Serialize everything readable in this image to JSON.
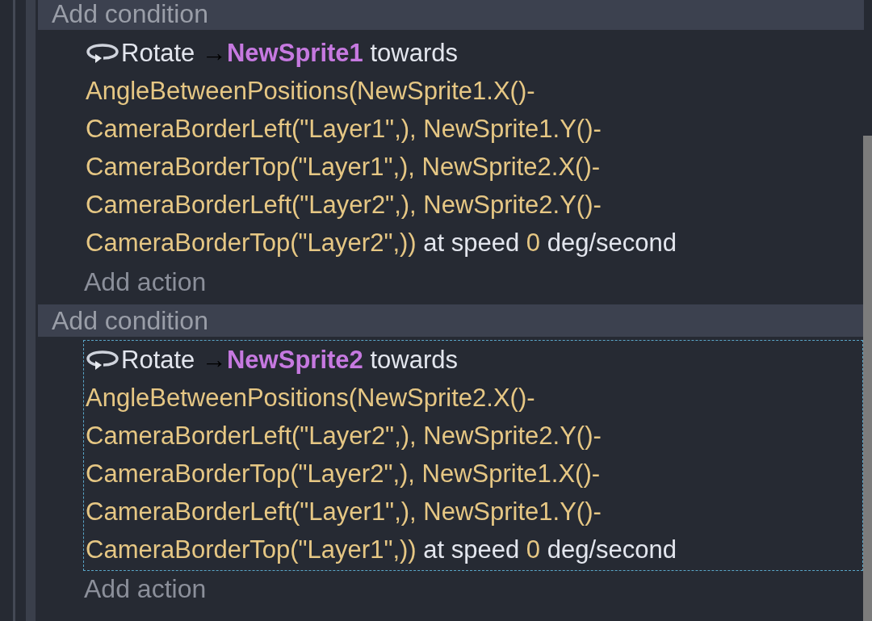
{
  "events": [
    {
      "condition_placeholder": "Add condition",
      "action": {
        "verb": "Rotate",
        "arrow": "→",
        "object": "NewSprite1",
        "connector": "towards",
        "expression": "AngleBetweenPositions(NewSprite1.X()-CameraBorderLeft(\"Layer1\",), NewSprite1.Y()-CameraBorderTop(\"Layer1\",), NewSprite2.X()-CameraBorderLeft(\"Layer2\",), NewSprite2.Y()-CameraBorderTop(\"Layer2\",))",
        "speed_label": "at speed",
        "speed": "0",
        "unit": "deg/second",
        "selected": false
      },
      "action_placeholder": "Add action"
    },
    {
      "condition_placeholder": "Add condition",
      "action": {
        "verb": "Rotate",
        "arrow": "→",
        "object": "NewSprite2",
        "connector": "towards",
        "expression": "AngleBetweenPositions(NewSprite2.X()-CameraBorderLeft(\"Layer2\",), NewSprite2.Y()-CameraBorderTop(\"Layer2\",), NewSprite1.X()-CameraBorderLeft(\"Layer1\",), NewSprite1.Y()-CameraBorderTop(\"Layer1\",))",
        "speed_label": "at speed",
        "speed": "0",
        "unit": "deg/second",
        "selected": true
      },
      "action_placeholder": "Add action"
    }
  ]
}
